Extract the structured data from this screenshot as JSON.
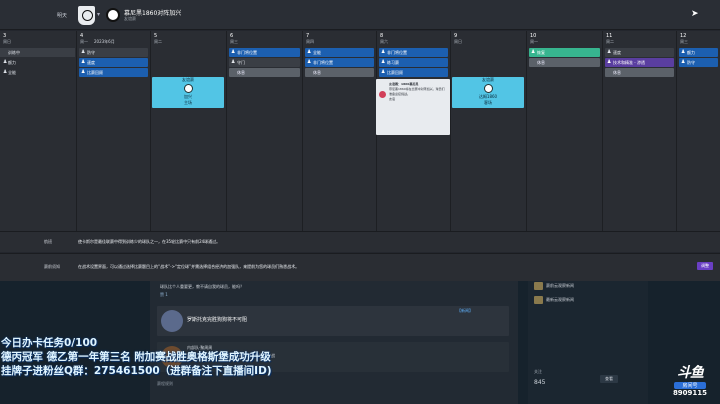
{
  "header": {
    "back_label": "明天",
    "club_name": "慕尼黑1860对阵加兴",
    "club_sub": "友谊赛",
    "cursor": "cursor-icon"
  },
  "sidebar": {
    "day": "3",
    "weekday": "周日",
    "items": [
      {
        "label": "训练中",
        "icon": "",
        "highlight": true
      },
      {
        "label": "额力",
        "icon": "♟",
        "highlight": false
      },
      {
        "label": "全能",
        "icon": "♟",
        "highlight": false
      }
    ]
  },
  "days": [
    {
      "day": "4",
      "weekday": "周一",
      "month": "2023年6月",
      "items": [
        {
          "label": "防守",
          "color": "dark",
          "icon": "♟"
        },
        {
          "label": "速度",
          "color": "blue",
          "icon": "♟"
        },
        {
          "label": "比赛回顾",
          "color": "blue",
          "icon": "♟"
        }
      ]
    },
    {
      "day": "5",
      "weekday": "周二",
      "month": "",
      "match": {
        "label": "友谊赛",
        "opponent": "加兴",
        "venue": "主场"
      }
    },
    {
      "day": "6",
      "weekday": "周三",
      "month": "",
      "items": [
        {
          "label": "非门将位置",
          "color": "blue",
          "icon": "♟"
        },
        {
          "label": "守门",
          "color": "dark",
          "icon": "♟"
        },
        {
          "label": "休息",
          "color": "grey",
          "icon": ""
        }
      ]
    },
    {
      "day": "7",
      "weekday": "周四",
      "month": "",
      "items": [
        {
          "label": "全能",
          "color": "blue",
          "icon": "♟"
        },
        {
          "label": "非门将位置",
          "color": "blue",
          "icon": "♟"
        },
        {
          "label": "休息",
          "color": "grey",
          "icon": ""
        }
      ]
    },
    {
      "day": "8",
      "weekday": "周六",
      "month": "",
      "items": [
        {
          "label": "非门将位置",
          "color": "blue",
          "icon": "♟"
        },
        {
          "label": "练习赛",
          "color": "blue",
          "icon": "♟"
        },
        {
          "label": "比赛回顾",
          "color": "blue",
          "icon": "♟"
        }
      ],
      "news": {
        "title": "友谊赛：1860慕尼黑",
        "body": "慕尼黑1860将在比赛中对阵加兴，球员们准备迎接挑战。",
        "tag": "友谊"
      }
    },
    {
      "day": "9",
      "weekday": "周日",
      "month": "",
      "match": {
        "label": "友谊赛",
        "opponent": "达姆1860",
        "venue": "客场"
      }
    },
    {
      "day": "10",
      "weekday": "周一",
      "month": "",
      "items": [
        {
          "label": "恢复",
          "color": "green",
          "icon": "♟"
        },
        {
          "label": "休息",
          "color": "grey",
          "icon": ""
        }
      ]
    },
    {
      "day": "11",
      "weekday": "周二",
      "month": "",
      "items": [
        {
          "label": "速度",
          "color": "dark",
          "icon": "♟"
        },
        {
          "label": "技术和精准 - 渗透",
          "color": "purple",
          "icon": "♟"
        },
        {
          "label": "休息",
          "color": "grey",
          "icon": ""
        }
      ]
    },
    {
      "day": "12",
      "weekday": "周三",
      "month": "",
      "items": [
        {
          "label": "额力",
          "color": "blue",
          "icon": "♟"
        },
        {
          "label": "防守",
          "color": "blue",
          "icon": "♟"
        }
      ]
    }
  ],
  "info": {
    "board_label": "航班",
    "board_text": "使卡斯尔是最佳联赛中得到训练少的球队之一，在35轮比赛中只有前24球通过。",
    "pre_match_label": "赛前须知",
    "pre_match_text": "在战术设置界面，可以通过选择比赛题目上的“战术”->“定位球”并需选择组合经济的加强队，来提前为您的球员们熟悉战术。",
    "button_label": "调整"
  },
  "inbox": {
    "line1": "球队比个人重要更，教不请自我的球员，能吗？",
    "likes": "赞 1",
    "row1_title": "罗斯托克完胜狗狗将不可阻",
    "row1_tag": "【新闻】",
    "row2_title": "内部队·聚周周",
    "row2_text": "球员们在比赛开始前表示将以积极的态度迎接挑战",
    "footer": "赛程规则",
    "right_items": [
      "赛前云观察新闻",
      "最新云观察新闻"
    ],
    "right_label": "关注",
    "right_value": "845",
    "right_button": "查看"
  },
  "overlay": {
    "line1": "今日办卡任务0/100",
    "line2": "德丙冠军 德乙第一年第三名 附加赛战胜奥格斯堡成功升级",
    "line3": "挂牌子进粉丝Q群：275461500（进群备注下直播间ID)",
    "logo_name": "斗鱼",
    "logo_sub": "房间号",
    "room_id": "8909115"
  }
}
